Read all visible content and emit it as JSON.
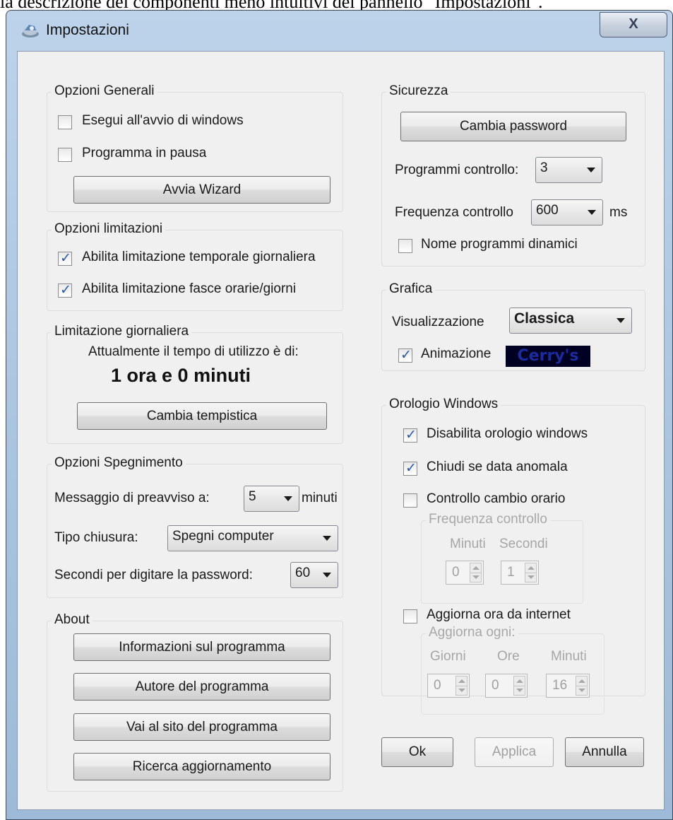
{
  "page_caption": "la descrizione dei componenti meno intuitivi del pannello \"Impostazioni\".",
  "window": {
    "title": "Impostazioni",
    "close_symbol": "X"
  },
  "opzioni_generali": {
    "legend": "Opzioni Generali",
    "esegui_avvio": {
      "label": "Esegui all'avvio di windows",
      "checked": false
    },
    "programma_pausa": {
      "label": "Programma in pausa",
      "checked": false
    },
    "avvia_wizard": "Avvia Wizard"
  },
  "opzioni_limitazioni": {
    "legend": "Opzioni limitazioni",
    "limitazione_temporale": {
      "label": "Abilita limitazione temporale giornaliera",
      "checked": true
    },
    "limitazione_fasce": {
      "label": "Abilita limitazione fasce orarie/giorni",
      "checked": true
    }
  },
  "limitazione_giornaliera": {
    "legend": "Limitazione giornaliera",
    "info": "Attualmente il tempo di utilizzo è di:",
    "tempo": "1 ora e 0 minuti",
    "cambia_tempistica": "Cambia tempistica"
  },
  "opzioni_spegnimento": {
    "legend": "Opzioni Spegnimento",
    "messaggio_label": "Messaggio di preavviso a:",
    "messaggio_value": "5",
    "messaggio_unit": "minuti",
    "tipo_label": "Tipo chiusura:",
    "tipo_value": "Spegni computer",
    "secondi_label": "Secondi per digitare la password:",
    "secondi_value": "60"
  },
  "about": {
    "legend": "About",
    "buttons": [
      "Informazioni sul programma",
      "Autore del programma",
      "Vai al sito del programma",
      "Ricerca aggiornamento"
    ]
  },
  "sicurezza": {
    "legend": "Sicurezza",
    "cambia_password": "Cambia password",
    "programmi_label": "Programmi controllo:",
    "programmi_value": "3",
    "frequenza_label": "Frequenza controllo",
    "frequenza_value": "600",
    "frequenza_unit": "ms",
    "nome_dinamici": {
      "label": "Nome programmi dinamici",
      "checked": false
    }
  },
  "grafica": {
    "legend": "Grafica",
    "visualizzazione_label": "Visualizzazione",
    "visualizzazione_value": "Classica",
    "animazione": {
      "label": "Animazione",
      "checked": true
    },
    "preview_text": "Cerry's"
  },
  "orologio": {
    "legend": "Orologio Windows",
    "disabilita": {
      "label": "Disabilita orologio windows",
      "checked": true
    },
    "chiudi": {
      "label": "Chiudi se data anomala",
      "checked": true
    },
    "controllo_cambio": {
      "label": "Controllo cambio orario",
      "checked": false
    },
    "frequenza": {
      "legend": "Frequenza controllo",
      "minuti_label": "Minuti",
      "secondi_label": "Secondi",
      "minuti_value": "0",
      "secondi_value": "1"
    },
    "aggiorna_internet": {
      "label": "Aggiorna ora da internet",
      "checked": false
    },
    "aggiorna_ogni": {
      "legend": "Aggiorna ogni:",
      "giorni_label": "Giorni",
      "ore_label": "Ore",
      "minuti_label": "Minuti",
      "giorni_value": "0",
      "ore_value": "0",
      "minuti_value": "16"
    }
  },
  "footer": {
    "ok": "Ok",
    "applica": "Applica",
    "annulla": "Annulla"
  }
}
